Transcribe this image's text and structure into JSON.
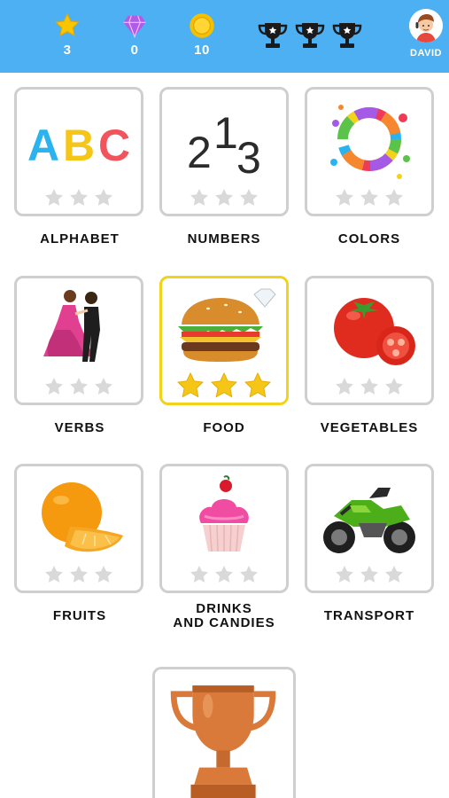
{
  "header": {
    "stats": [
      {
        "icon": "star-icon",
        "value": "3"
      },
      {
        "icon": "diamond-icon",
        "value": "0"
      },
      {
        "icon": "coin-icon",
        "value": "10"
      }
    ],
    "trophies": [
      "trophy-icon",
      "trophy-icon",
      "trophy-icon"
    ],
    "profile_name": "DAVID"
  },
  "categories": [
    {
      "label": "ALPHABET",
      "stars_earned": 0,
      "stars_total": 3
    },
    {
      "label": "NUMBERS",
      "stars_earned": 0,
      "stars_total": 3
    },
    {
      "label": "COLORS",
      "stars_earned": 0,
      "stars_total": 3
    },
    {
      "label": "VERBS",
      "stars_earned": 0,
      "stars_total": 3
    },
    {
      "label": "FOOD",
      "stars_earned": 3,
      "stars_total": 3
    },
    {
      "label": "VEGETABLES",
      "stars_earned": 0,
      "stars_total": 3
    },
    {
      "label": "FRUITS",
      "stars_earned": 0,
      "stars_total": 3
    },
    {
      "label_line1": "DRINKS",
      "label_line2": "AND CANDIES",
      "stars_earned": 0,
      "stars_total": 3
    },
    {
      "label": "TRANSPORT",
      "stars_earned": 0,
      "stars_total": 3
    }
  ],
  "alphabet_art": {
    "a": "A",
    "b": "B",
    "c": "C"
  },
  "numbers_art": {
    "n1": "2",
    "n2": "1",
    "n3": "3"
  },
  "colors": {
    "header": "#4db0f3",
    "gold": "#f5c518",
    "grey_star": "#d9d9d9",
    "active_border": "#f2d21b"
  }
}
